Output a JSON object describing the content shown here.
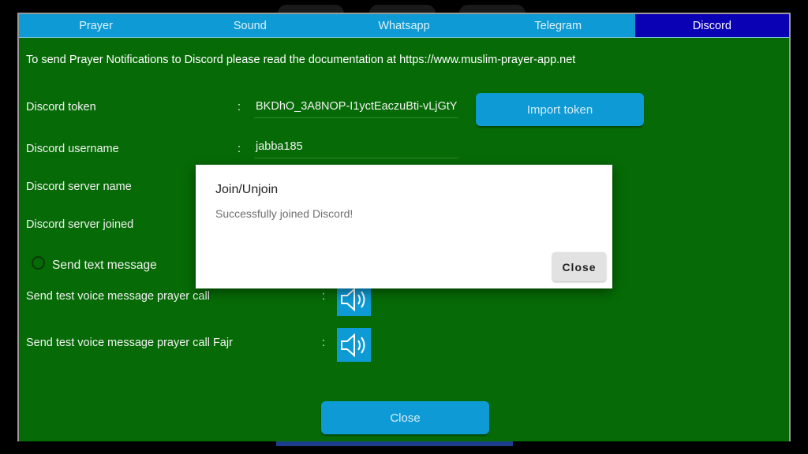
{
  "tabs": [
    {
      "label": "Prayer"
    },
    {
      "label": "Sound"
    },
    {
      "label": "Whatsapp"
    },
    {
      "label": "Telegram"
    },
    {
      "label": "Discord"
    }
  ],
  "doc_text": "To send Prayer Notifications to Discord please read the documentation at https://www.muslim-prayer-app.net",
  "colon": ":",
  "form": {
    "token_label": "Discord token",
    "token_value": "BKDhO_3A8NOP-I1yctEaczuBti-vLjGtY",
    "import_button": "Import token",
    "username_label": "Discord username",
    "username_value": "jabba185",
    "server_name_label": "Discord server name",
    "server_joined_label": "Discord server joined",
    "send_text_label": "Send text message",
    "voice_label": "Send test voice message prayer call",
    "voice_fajr_label": "Send test voice message prayer call Fajr"
  },
  "close_button": "Close",
  "dialog": {
    "title": "Join/Unjoin",
    "message": "Successfully joined Discord!",
    "close": "Close"
  },
  "colors": {
    "panel_bg": "#066b06",
    "tab_bg": "#0e9ad4",
    "tab_active": "#0a00b4",
    "button_bg": "#0e9ad4"
  },
  "icons": {
    "speaker": "speaker-icon",
    "radio": "radio-button"
  }
}
